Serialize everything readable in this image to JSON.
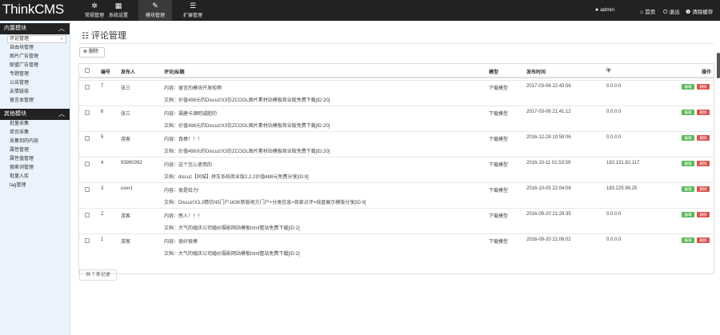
{
  "app": {
    "brand": "ThinkCMS"
  },
  "topnav": [
    {
      "label": "常规管理",
      "icon": "cogs-icon",
      "glyph": "✲"
    },
    {
      "label": "系统设置",
      "icon": "grid-icon",
      "glyph": "▦"
    },
    {
      "label": "模块管理",
      "icon": "wrench-icon",
      "glyph": "✎"
    },
    {
      "label": "扩展管理",
      "icon": "list-icon",
      "glyph": "☰"
    }
  ],
  "topright": {
    "user": "admin",
    "home": "首页",
    "logout": "退出",
    "clear_cache": "清除缓存"
  },
  "sidebar": {
    "section1": {
      "title": "内置模块",
      "items": [
        "评论管理",
        "自由块管理",
        "图片广告管理",
        "联盟广告管理",
        "专题管理",
        "公告管理",
        "友情链接",
        "留言本管理"
      ]
    },
    "section2": {
      "title": "其他模块",
      "items": [
        "批量采集",
        "单页采集",
        "采集到的内容",
        "属性管理",
        "属性值管理",
        "搜索词管理",
        "批量入库",
        "tag管理"
      ]
    }
  },
  "page": {
    "title": "评论管理",
    "delete_button": "删除",
    "record_count": "共 7 条记录"
  },
  "table": {
    "headers": {
      "id": "编号",
      "author": "发布人",
      "comment": "评论|标题",
      "model": "模型",
      "time": "发布时间",
      "ip": "ip",
      "ops": "操作"
    },
    "edit_label": "编辑",
    "delete_label": "删除",
    "rows": [
      {
        "id": "7",
        "author": "张三",
        "content": "内容：留言的模块开发啦啊",
        "title": "文档：价值498元的Discuz!X3仿ZCOOL图片素材站模板商业版免费下载[ID:20]",
        "model": "下载模型",
        "time": "2017-03-06 22:43:56",
        "ip": "0.0.0.0"
      },
      {
        "id": "6",
        "author": "张三",
        "content": "内容：福建卡酒吧减肥的",
        "title": "文档：价值498元的Discuz!X3仿ZCOOL图片素材站模板商业版免费下载[ID:20]",
        "model": "下载模型",
        "time": "2017-03-06 21:41:12",
        "ip": "0.0.0.0"
      },
      {
        "id": "5",
        "author": "游客",
        "content": "内容：真棒！！！",
        "title": "文档：价值498元的Discuz!X3仿ZCOOL图片素材站模板商业版免费下载[ID:20]",
        "model": "下载模型",
        "time": "2016-12-28 10:59:06",
        "ip": "0.0.0.0"
      },
      {
        "id": "4",
        "author": "93990392",
        "content": "内容：这个怎么使用的",
        "title": "文档：discuz【同城】拼车系统商业版2.2.2价值488元免费分享[ID:8]",
        "model": "下载模型",
        "time": "2016-10-11 01:53:59",
        "ip": "182.131.82.117"
      },
      {
        "id": "3",
        "author": "user1",
        "content": "内容：很是给力!",
        "title": "文档：Discuz!X3.2精仿N5门户163K新版地方门户+分类信息+商家点评+线盘展示模版分享[ID:9]",
        "model": "下载模型",
        "time": "2016-10-05 22:04:08",
        "ip": "183.225.96.25"
      },
      {
        "id": "2",
        "author": "游客",
        "content": "内容：感人！！！",
        "title": "文档：大气的婚庆公司婚纱摄影网站模板html整站免费下载[ID:2]",
        "model": "下载模型",
        "time": "2016-09-20 21:29:35",
        "ip": "0.0.0.0"
      },
      {
        "id": "1",
        "author": "游客",
        "content": "内容：很好很棒",
        "title": "文档：大气的婚庆公司婚纱摄影网站模板html整站免费下载[ID:2]",
        "model": "下载模型",
        "time": "2016-09-20 21:06:02",
        "ip": "0.0.0.0"
      }
    ]
  }
}
